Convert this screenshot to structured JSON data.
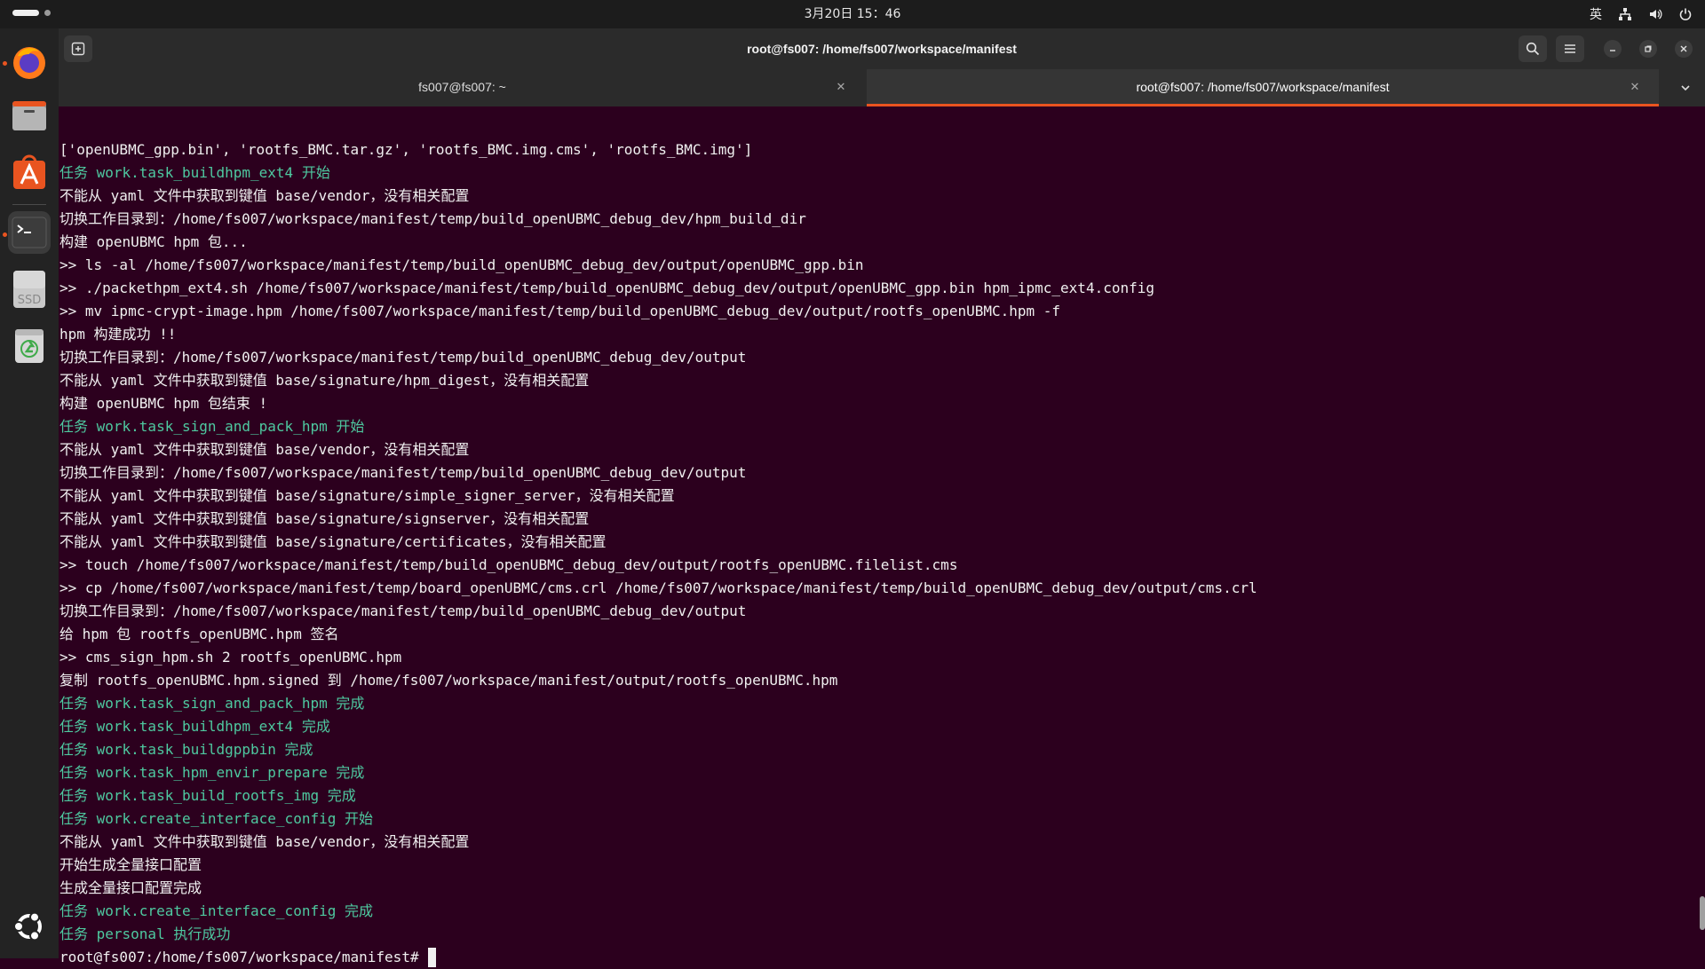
{
  "topbar": {
    "clock": "3月20日 15：46",
    "input_method": "英",
    "icons": [
      "activities-indicator",
      "network-icon",
      "volume-icon",
      "power-icon"
    ]
  },
  "dock": {
    "apps": [
      {
        "name": "firefox",
        "icon": "firefox-icon",
        "running": true
      },
      {
        "name": "files",
        "icon": "files-icon",
        "running": false
      },
      {
        "name": "app-center",
        "icon": "app-center-icon",
        "running": false
      },
      {
        "name": "terminal",
        "icon": "terminal-icon",
        "running": true
      },
      {
        "name": "ssd-drive",
        "icon": "ssd-drive-icon",
        "label": "SSD",
        "running": false
      },
      {
        "name": "trash",
        "icon": "trash-icon",
        "running": false
      }
    ],
    "show_apps_icon": "ubuntu-logo-icon"
  },
  "window": {
    "title": "root@fs007: /home/fs007/workspace/manifest",
    "tabs": [
      {
        "label": "fs007@fs007: ~",
        "active": false
      },
      {
        "label": "root@fs007: /home/fs007/workspace/manifest",
        "active": true
      }
    ],
    "accent": "#e95420"
  },
  "terminal": {
    "background": "#2c001e",
    "info_color": "#4ec9a0",
    "lines": [
      {
        "text": "['openUBMC_gpp.bin', 'rootfs_BMC.tar.gz', 'rootfs_BMC.img.cms', 'rootfs_BMC.img']",
        "type": "normal"
      },
      {
        "text": "任务 work.task_buildhpm_ext4 开始",
        "type": "info"
      },
      {
        "text": "不能从 yaml 文件中获取到键值 base/vendor，没有相关配置",
        "type": "normal"
      },
      {
        "text": "切换工作目录到：/home/fs007/workspace/manifest/temp/build_openUBMC_debug_dev/hpm_build_dir",
        "type": "normal"
      },
      {
        "text": "构建 openUBMC hpm 包...",
        "type": "normal"
      },
      {
        "text": ">> ls -al /home/fs007/workspace/manifest/temp/build_openUBMC_debug_dev/output/openUBMC_gpp.bin",
        "type": "normal"
      },
      {
        "text": ">> ./packethpm_ext4.sh /home/fs007/workspace/manifest/temp/build_openUBMC_debug_dev/output/openUBMC_gpp.bin hpm_ipmc_ext4.config",
        "type": "normal"
      },
      {
        "text": ">> mv ipmc-crypt-image.hpm /home/fs007/workspace/manifest/temp/build_openUBMC_debug_dev/output/rootfs_openUBMC.hpm -f",
        "type": "normal"
      },
      {
        "text": "hpm 构建成功 !!",
        "type": "normal"
      },
      {
        "text": "切换工作目录到：/home/fs007/workspace/manifest/temp/build_openUBMC_debug_dev/output",
        "type": "normal"
      },
      {
        "text": "不能从 yaml 文件中获取到键值 base/signature/hpm_digest，没有相关配置",
        "type": "normal"
      },
      {
        "text": "构建 openUBMC hpm 包结束 !",
        "type": "normal"
      },
      {
        "text": "任务 work.task_sign_and_pack_hpm 开始",
        "type": "info"
      },
      {
        "text": "不能从 yaml 文件中获取到键值 base/vendor，没有相关配置",
        "type": "normal"
      },
      {
        "text": "切换工作目录到：/home/fs007/workspace/manifest/temp/build_openUBMC_debug_dev/output",
        "type": "normal"
      },
      {
        "text": "不能从 yaml 文件中获取到键值 base/signature/simple_signer_server，没有相关配置",
        "type": "normal"
      },
      {
        "text": "不能从 yaml 文件中获取到键值 base/signature/signserver，没有相关配置",
        "type": "normal"
      },
      {
        "text": "不能从 yaml 文件中获取到键值 base/signature/certificates，没有相关配置",
        "type": "normal"
      },
      {
        "text": ">> touch /home/fs007/workspace/manifest/temp/build_openUBMC_debug_dev/output/rootfs_openUBMC.filelist.cms",
        "type": "normal"
      },
      {
        "text": ">> cp /home/fs007/workspace/manifest/temp/board_openUBMC/cms.crl /home/fs007/workspace/manifest/temp/build_openUBMC_debug_dev/output/cms.crl",
        "type": "normal"
      },
      {
        "text": "切换工作目录到：/home/fs007/workspace/manifest/temp/build_openUBMC_debug_dev/output",
        "type": "normal"
      },
      {
        "text": "给 hpm 包 rootfs_openUBMC.hpm 签名",
        "type": "normal"
      },
      {
        "text": ">> cms_sign_hpm.sh 2 rootfs_openUBMC.hpm",
        "type": "normal"
      },
      {
        "text": "复制 rootfs_openUBMC.hpm.signed 到 /home/fs007/workspace/manifest/output/rootfs_openUBMC.hpm",
        "type": "normal"
      },
      {
        "text": "任务 work.task_sign_and_pack_hpm 完成",
        "type": "info"
      },
      {
        "text": "任务 work.task_buildhpm_ext4 完成",
        "type": "info"
      },
      {
        "text": "任务 work.task_buildgppbin 完成",
        "type": "info"
      },
      {
        "text": "任务 work.task_hpm_envir_prepare 完成",
        "type": "info"
      },
      {
        "text": "任务 work.task_build_rootfs_img 完成",
        "type": "info"
      },
      {
        "text": "任务 work.create_interface_config 开始",
        "type": "info"
      },
      {
        "text": "不能从 yaml 文件中获取到键值 base/vendor，没有相关配置",
        "type": "normal"
      },
      {
        "text": "开始生成全量接口配置",
        "type": "normal"
      },
      {
        "text": "生成全量接口配置完成",
        "type": "normal"
      },
      {
        "text": "任务 work.create_interface_config 完成",
        "type": "info"
      },
      {
        "text": "任务 personal 执行成功",
        "type": "info"
      }
    ],
    "prompt": "root@fs007:/home/fs007/workspace/manifest#"
  }
}
